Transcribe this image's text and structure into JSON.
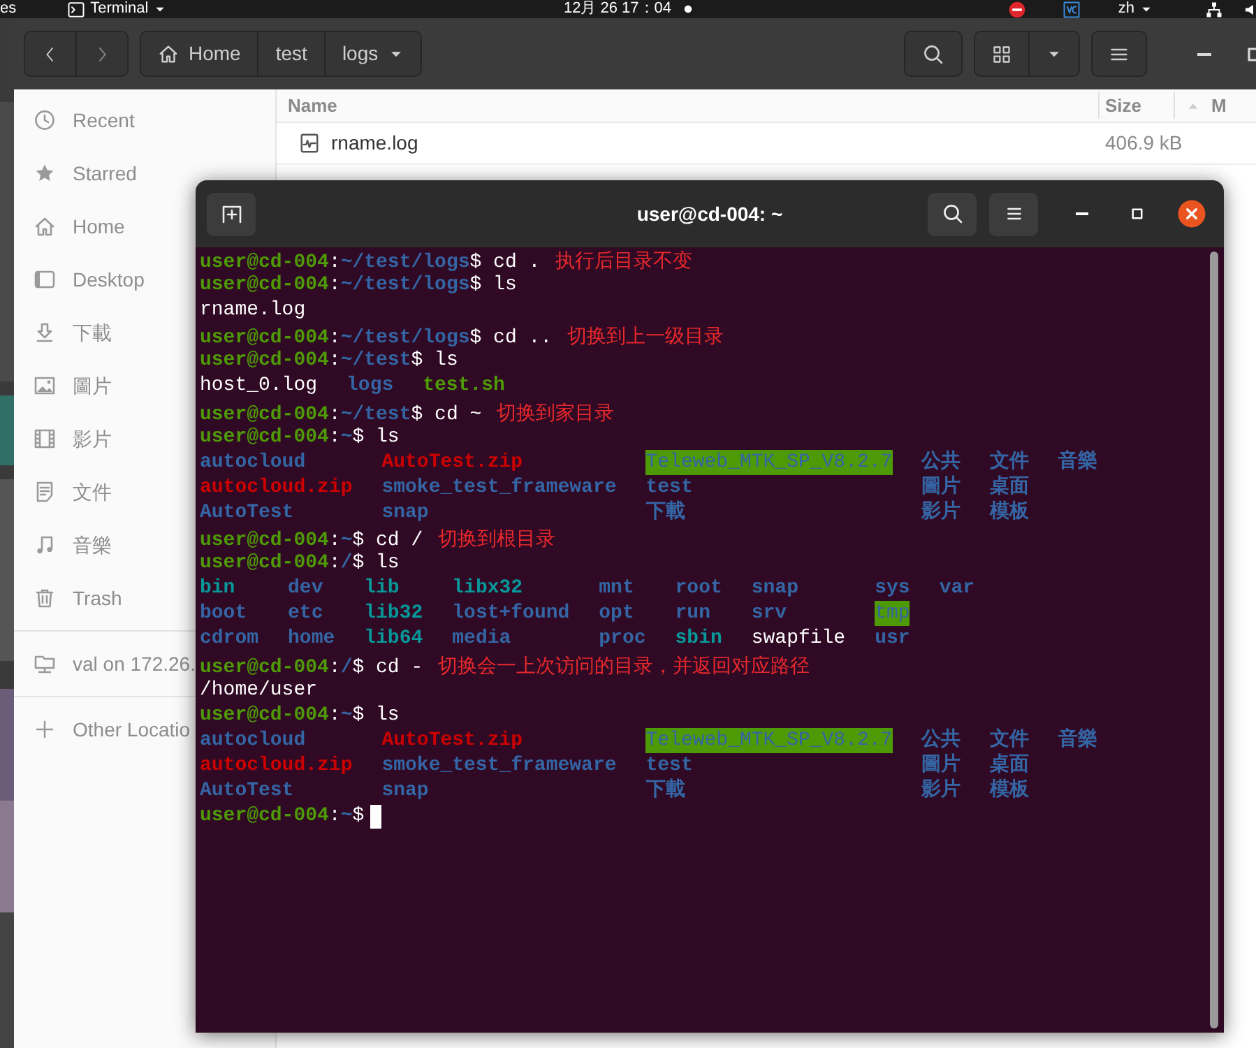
{
  "top_bar": {
    "left_text": "es",
    "app": "Terminal",
    "clock": "12月 26  17：04",
    "language": "zh"
  },
  "files_window": {
    "path": [
      {
        "label": "Home",
        "kind": "home"
      },
      {
        "label": "test",
        "kind": "folder"
      },
      {
        "label": "logs",
        "kind": "current"
      }
    ],
    "places": [
      {
        "label": "Recent",
        "kind": "recent"
      },
      {
        "label": "Starred",
        "kind": "starred"
      },
      {
        "label": "Home",
        "kind": "home"
      },
      {
        "label": "Desktop",
        "kind": "desktop"
      },
      {
        "label": "下載",
        "kind": "downloads"
      },
      {
        "label": "圖片",
        "kind": "pictures"
      },
      {
        "label": "影片",
        "kind": "videos"
      },
      {
        "label": "文件",
        "kind": "documents"
      },
      {
        "label": "音樂",
        "kind": "music"
      },
      {
        "label": "Trash",
        "kind": "trash"
      }
    ],
    "locations": [
      {
        "label": "val on 172.26.",
        "kind": "share"
      },
      {
        "label": "Other Locatio",
        "kind": "other"
      }
    ],
    "columns": [
      "Name",
      "Size",
      "M"
    ],
    "rows": [
      {
        "name": "rname.log",
        "size": "406.9 kB"
      }
    ]
  },
  "terminal": {
    "title": "user@cd-004: ~",
    "lines": [
      {
        "kind": "prompt",
        "user": "user@cd-004",
        "sep": ":",
        "path": "~/test/logs",
        "symbol": "$",
        "command": "cd .",
        "note": "执行后目录不变"
      },
      {
        "kind": "prompt",
        "user": "user@cd-004",
        "sep": ":",
        "path": "~/test/logs",
        "symbol": "$",
        "command": "ls"
      },
      {
        "kind": "output",
        "text": "rname.log"
      },
      {
        "kind": "prompt",
        "user": "user@cd-004",
        "sep": ":",
        "path": "~/test/logs",
        "symbol": "$",
        "command": "cd ..",
        "note": "切换到上一级目录"
      },
      {
        "kind": "prompt",
        "user": "user@cd-004",
        "sep": ":",
        "path": "~/test",
        "symbol": "$",
        "command": "ls"
      },
      {
        "kind": "listing",
        "columns": [
          [
            {
              "name": "host_0.log",
              "kind": "file"
            }
          ],
          [
            {
              "name": "logs",
              "kind": "dir"
            }
          ],
          [
            {
              "name": "test.sh",
              "kind": "exec"
            }
          ]
        ]
      },
      {
        "kind": "prompt",
        "user": "user@cd-004",
        "sep": ":",
        "path": "~/test",
        "symbol": "$",
        "command": "cd ~",
        "note": "切换到家目录"
      },
      {
        "kind": "prompt",
        "user": "user@cd-004",
        "sep": ":",
        "path": "~",
        "symbol": "$",
        "command": "ls"
      },
      {
        "kind": "listing",
        "columns": [
          [
            {
              "name": "autocloud",
              "kind": "dir"
            },
            {
              "name": "autocloud.zip",
              "kind": "archive"
            },
            {
              "name": "AutoTest",
              "kind": "dir"
            }
          ],
          [
            {
              "name": "AutoTest.zip",
              "kind": "archive"
            },
            {
              "name": "smoke_test_frameware",
              "kind": "dir"
            },
            {
              "name": "snap",
              "kind": "dir"
            }
          ],
          [
            {
              "name": "Teleweb_MTK_SP_V8.2.7",
              "kind": "sticky"
            },
            {
              "name": "test",
              "kind": "dir"
            },
            {
              "name": "下載",
              "kind": "dir"
            }
          ],
          [
            {
              "name": "公共",
              "kind": "dir"
            },
            {
              "name": "圖片",
              "kind": "dir"
            },
            {
              "name": "影片",
              "kind": "dir"
            }
          ],
          [
            {
              "name": "文件",
              "kind": "dir"
            },
            {
              "name": "桌面",
              "kind": "dir"
            },
            {
              "name": "模板",
              "kind": "dir"
            }
          ],
          [
            {
              "name": "音樂",
              "kind": "dir"
            }
          ]
        ]
      },
      {
        "kind": "prompt",
        "user": "user@cd-004",
        "sep": ":",
        "path": "~",
        "symbol": "$",
        "command": "cd /",
        "note": "切换到根目录"
      },
      {
        "kind": "prompt",
        "user": "user@cd-004",
        "sep": ":",
        "path": "/",
        "symbol": "$",
        "command": "ls"
      },
      {
        "kind": "listing",
        "columns": [
          [
            {
              "name": "bin",
              "kind": "link"
            },
            {
              "name": "boot",
              "kind": "dir"
            },
            {
              "name": "cdrom",
              "kind": "dir"
            }
          ],
          [
            {
              "name": "dev",
              "kind": "dir"
            },
            {
              "name": "etc",
              "kind": "dir"
            },
            {
              "name": "home",
              "kind": "dir"
            }
          ],
          [
            {
              "name": "lib",
              "kind": "link"
            },
            {
              "name": "lib32",
              "kind": "link"
            },
            {
              "name": "lib64",
              "kind": "link"
            }
          ],
          [
            {
              "name": "libx32",
              "kind": "link"
            },
            {
              "name": "lost+found",
              "kind": "dir"
            },
            {
              "name": "media",
              "kind": "dir"
            }
          ],
          [
            {
              "name": "mnt",
              "kind": "dir"
            },
            {
              "name": "opt",
              "kind": "dir"
            },
            {
              "name": "proc",
              "kind": "dir"
            }
          ],
          [
            {
              "name": "root",
              "kind": "dir"
            },
            {
              "name": "run",
              "kind": "dir"
            },
            {
              "name": "sbin",
              "kind": "link"
            }
          ],
          [
            {
              "name": "snap",
              "kind": "dir"
            },
            {
              "name": "srv",
              "kind": "dir"
            },
            {
              "name": "swapfile",
              "kind": "file"
            }
          ],
          [
            {
              "name": "sys",
              "kind": "dir"
            },
            {
              "name": "tmp",
              "kind": "sticky"
            },
            {
              "name": "usr",
              "kind": "dir"
            }
          ],
          [
            {
              "name": "var",
              "kind": "dir"
            }
          ]
        ]
      },
      {
        "kind": "prompt",
        "user": "user@cd-004",
        "sep": ":",
        "path": "/",
        "symbol": "$",
        "command": "cd -",
        "note": "切换会一上次访问的目录，并返回对应路径"
      },
      {
        "kind": "output",
        "text": "/home/user"
      },
      {
        "kind": "prompt",
        "user": "user@cd-004",
        "sep": ":",
        "path": "~",
        "symbol": "$",
        "command": "ls"
      },
      {
        "kind": "listing",
        "columns": [
          [
            {
              "name": "autocloud",
              "kind": "dir"
            },
            {
              "name": "autocloud.zip",
              "kind": "archive"
            },
            {
              "name": "AutoTest",
              "kind": "dir"
            }
          ],
          [
            {
              "name": "AutoTest.zip",
              "kind": "archive"
            },
            {
              "name": "smoke_test_frameware",
              "kind": "dir"
            },
            {
              "name": "snap",
              "kind": "dir"
            }
          ],
          [
            {
              "name": "Teleweb_MTK_SP_V8.2.7",
              "kind": "sticky"
            },
            {
              "name": "test",
              "kind": "dir"
            },
            {
              "name": "下載",
              "kind": "dir"
            }
          ],
          [
            {
              "name": "公共",
              "kind": "dir"
            },
            {
              "name": "圖片",
              "kind": "dir"
            },
            {
              "name": "影片",
              "kind": "dir"
            }
          ],
          [
            {
              "name": "文件",
              "kind": "dir"
            },
            {
              "name": "桌面",
              "kind": "dir"
            },
            {
              "name": "模板",
              "kind": "dir"
            }
          ],
          [
            {
              "name": "音樂",
              "kind": "dir"
            }
          ]
        ]
      },
      {
        "kind": "prompt",
        "user": "user@cd-004",
        "sep": ":",
        "path": "~",
        "symbol": "$",
        "cursor": true
      }
    ]
  }
}
